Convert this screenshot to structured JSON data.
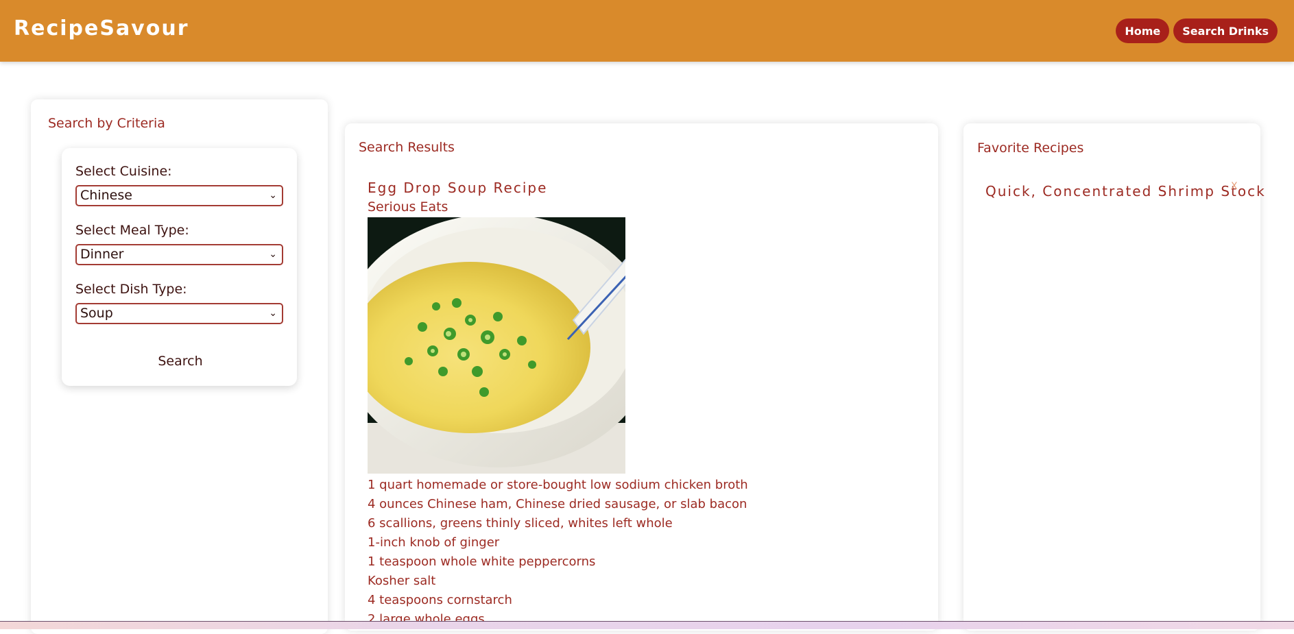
{
  "header": {
    "brand": "RecipeSavour",
    "nav": [
      {
        "label": "Home"
      },
      {
        "label": "Search Drinks"
      }
    ]
  },
  "criteria": {
    "title": "Search by Criteria",
    "cuisine_label": "Select Cuisine:",
    "cuisine_value": "Chinese",
    "meal_label": "Select Meal Type:",
    "meal_value": "Dinner",
    "dish_label": "Select Dish Type:",
    "dish_value": "Soup",
    "search_label": "Search"
  },
  "results": {
    "title": "Search Results",
    "recipe": {
      "title": "Egg Drop Soup Recipe",
      "source": "Serious Eats",
      "image_alt": "bowl of egg drop soup with scallions",
      "ingredients": [
        "1 quart homemade or store-bought low sodium chicken broth",
        "4 ounces Chinese ham, Chinese dried sausage, or slab bacon",
        "6 scallions, greens thinly sliced, whites left whole",
        "1-inch knob of ginger",
        "1 teaspoon whole white peppercorns",
        "Kosher salt",
        "4 teaspoons cornstarch",
        "2 large whole eggs"
      ]
    }
  },
  "favorites": {
    "title": "Favorite Recipes",
    "items": [
      {
        "name": "Quick, Concentrated Shrimp Stock",
        "remove": "X"
      }
    ]
  },
  "colors": {
    "header": "#d98a2b",
    "accent": "#a8201a",
    "text": "#9c2a22"
  }
}
